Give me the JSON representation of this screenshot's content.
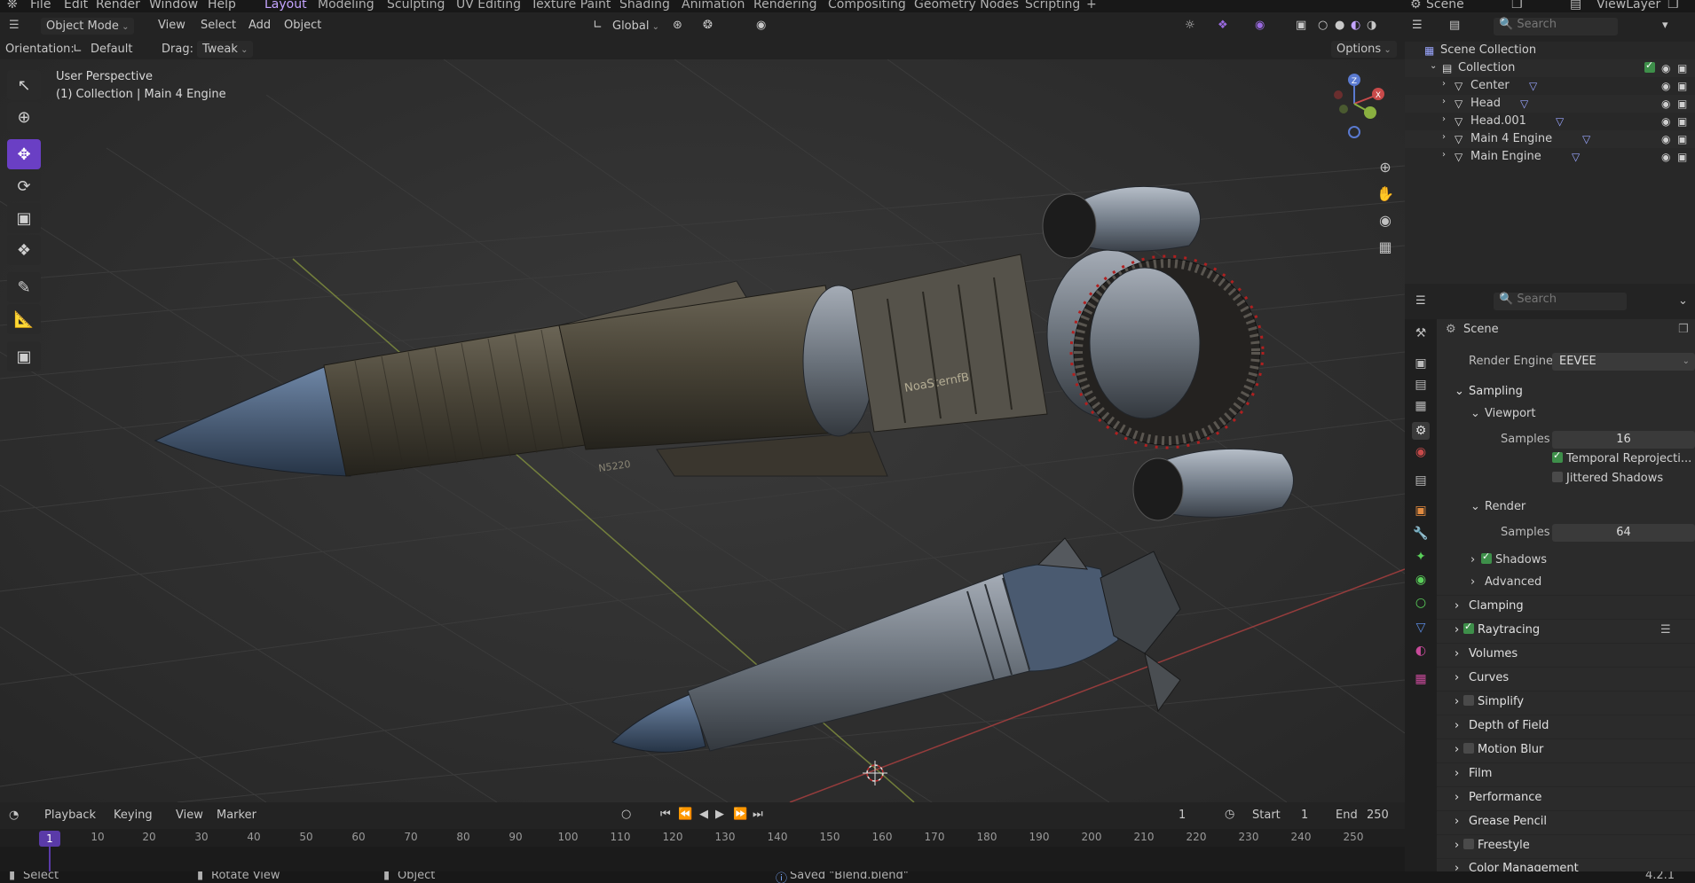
{
  "menu": {
    "items": [
      "File",
      "Edit",
      "Render",
      "Window",
      "Help"
    ]
  },
  "workspaces": {
    "tabs": [
      "Layout",
      "Modeling",
      "Sculpting",
      "UV Editing",
      "Texture Paint",
      "Shading",
      "Animation",
      "Rendering",
      "Compositing",
      "Geometry Nodes",
      "Scripting"
    ],
    "active": "Layout",
    "add": "+"
  },
  "top_right": {
    "scene": "Scene",
    "view_layer": "ViewLayer"
  },
  "viewport_header": {
    "mode": "Object Mode",
    "menus": [
      "View",
      "Select",
      "Add",
      "Object"
    ],
    "transform_orientation": "Global",
    "orientation_label": "Orientation:",
    "orientation_value": "Default",
    "drag_label": "Drag:",
    "drag_value": "Tweak",
    "options": "Options"
  },
  "viewport": {
    "view_name": "User Perspective",
    "context": "(1) Collection | Main 4 Engine",
    "rocket_text_1": "NoaSternfB",
    "rocket_text_2": "N5220",
    "gizmo_axes": [
      "Z",
      "X",
      "Y"
    ]
  },
  "timeline": {
    "menus": [
      "Playback",
      "Keying",
      "View",
      "Marker"
    ],
    "current_frame": "1",
    "start_label": "Start",
    "start": "1",
    "end_label": "End",
    "end": "250",
    "ticks": [
      "1",
      "10",
      "20",
      "30",
      "40",
      "50",
      "60",
      "70",
      "80",
      "90",
      "100",
      "110",
      "120",
      "130",
      "140",
      "150",
      "160",
      "170",
      "180",
      "190",
      "200",
      "210",
      "220",
      "230",
      "240",
      "250"
    ]
  },
  "statusbar": {
    "select": "Select",
    "rotate": "Rotate View",
    "object": "Object",
    "message": "Saved \"Blend.blend\"",
    "version": "4.2.1"
  },
  "outliner": {
    "search_placeholder": "Search",
    "scene_collection": "Scene Collection",
    "collection": "Collection",
    "objects": [
      "Center",
      "Head",
      "Head.001",
      "Main 4 Engine",
      "Main Engine"
    ]
  },
  "properties": {
    "search_placeholder": "Search",
    "context": "Scene",
    "render_engine_label": "Render Engine",
    "render_engine": "EEVEE",
    "sampling": "Sampling",
    "viewport": "Viewport",
    "viewport_samples_label": "Samples",
    "viewport_samples": "16",
    "temporal_reprojection": "Temporal Reprojecti...",
    "jittered_shadows": "Jittered Shadows",
    "render": "Render",
    "render_samples_label": "Samples",
    "render_samples": "64",
    "shadows": "Shadows",
    "advanced": "Advanced",
    "sections": [
      "Clamping",
      "Raytracing",
      "Volumes",
      "Curves",
      "Simplify",
      "Depth of Field",
      "Motion Blur",
      "Film",
      "Performance",
      "Grease Pencil",
      "Freestyle",
      "Color Management"
    ]
  },
  "colors": {
    "accent": "#6a3fc4",
    "active_tab": "#c4a4ff",
    "checkbox_on": "#3e8f4a",
    "axis_x": "#b04040",
    "axis_y": "#8fa040"
  }
}
